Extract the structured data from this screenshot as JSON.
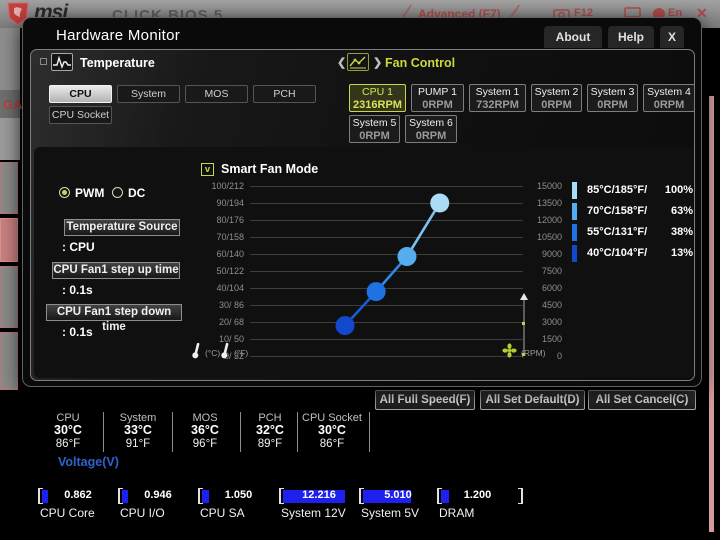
{
  "top_bar": {
    "logo_text": "msi",
    "bios_title": "CLICK BIOS 5",
    "advanced": "Advanced (F7)",
    "f12": "F12",
    "lang": "En",
    "close": "✕",
    "ga_label": "GA"
  },
  "dialog": {
    "title": "Hardware Monitor",
    "buttons": {
      "about": "About",
      "help": "Help",
      "close": "X"
    },
    "temperature": {
      "title": "Temperature",
      "tabs": [
        {
          "label": "CPU",
          "selected": true
        },
        {
          "label": "System",
          "selected": false
        },
        {
          "label": "MOS",
          "selected": false
        },
        {
          "label": "PCH",
          "selected": false
        },
        {
          "label": "CPU Socket",
          "selected": false
        }
      ]
    },
    "fan_control": {
      "title": "Fan Control",
      "fans": [
        {
          "name": "CPU 1",
          "rpm": "2316RPM",
          "selected": true
        },
        {
          "name": "PUMP 1",
          "rpm": "0RPM",
          "selected": false
        },
        {
          "name": "System 1",
          "rpm": "732RPM",
          "selected": false
        },
        {
          "name": "System 2",
          "rpm": "0RPM",
          "selected": false
        },
        {
          "name": "System 3",
          "rpm": "0RPM",
          "selected": false
        },
        {
          "name": "System 4",
          "rpm": "0RPM",
          "selected": false
        },
        {
          "name": "System 5",
          "rpm": "0RPM",
          "selected": false
        },
        {
          "name": "System 6",
          "rpm": "0RPM",
          "selected": false
        }
      ]
    },
    "controls": {
      "pwm_label": "PWM",
      "dc_label": "DC",
      "selected_mode": "PWM",
      "settings": [
        {
          "label": "Temperature Source",
          "value": ": CPU"
        },
        {
          "label": "CPU Fan1 step up time",
          "value": ": 0.1s"
        },
        {
          "label": "CPU Fan1 step down time",
          "value": ": 0.1s"
        }
      ]
    },
    "smart_fan": {
      "label": "Smart Fan Mode",
      "checked": true,
      "check_glyph": "v"
    },
    "chart_data": {
      "type": "line",
      "title": "Smart Fan Mode fan curve",
      "x_axis_units": [
        "(°C)",
        "(°F)"
      ],
      "y_right_unit": "(RPM)",
      "points": [
        {
          "temp_c": 40,
          "temp_f": 104,
          "duty_pct": 13
        },
        {
          "temp_c": 55,
          "temp_f": 131,
          "duty_pct": 38
        },
        {
          "temp_c": 70,
          "temp_f": 158,
          "duty_pct": 63
        },
        {
          "temp_c": 85,
          "temp_f": 185,
          "duty_pct": 100
        }
      ],
      "point_fracs": [
        [
          0.348,
          0.179
        ],
        [
          0.462,
          0.379
        ],
        [
          0.575,
          0.585
        ],
        [
          0.695,
          0.9
        ]
      ],
      "point_colors": [
        "#1148cc",
        "#1e72e2",
        "#55acee",
        "#aadcf6"
      ],
      "segment_colors": [
        "#1b5ad6",
        "#2f8ae6",
        "#7cc2f0"
      ],
      "left_ticks": [
        "100/212",
        "90/194",
        "80/176",
        "70/158",
        "60/140",
        "50/122",
        "40/104",
        "30/ 86",
        "20/ 68",
        "10/ 50",
        "0/ 32"
      ],
      "right_ticks": [
        "15000",
        "13500",
        "12000",
        "10500",
        "9000",
        "7500",
        "6000",
        "4500",
        "3000",
        "1500",
        "0"
      ],
      "grid": true
    },
    "legend": [
      {
        "label": "85°C/185°F/",
        "pct": "100%",
        "color": "#aadcf6"
      },
      {
        "label": "70°C/158°F/",
        "pct": "63%",
        "color": "#55acee"
      },
      {
        "label": "55°C/131°F/",
        "pct": "38%",
        "color": "#1e72e2"
      },
      {
        "label": "40°C/104°F/",
        "pct": "13%",
        "color": "#1148cc"
      }
    ]
  },
  "action_buttons": [
    "All Full Speed(F)",
    "All Set Default(D)",
    "All Set Cancel(C)"
  ],
  "status": {
    "temps": [
      {
        "label": "CPU",
        "c": "30°C",
        "f": "86°F"
      },
      {
        "label": "System",
        "c": "33°C",
        "f": "91°F"
      },
      {
        "label": "MOS",
        "c": "36°C",
        "f": "96°F"
      },
      {
        "label": "PCH",
        "c": "32°C",
        "f": "89°F"
      },
      {
        "label": "CPU Socket",
        "c": "30°C",
        "f": "86°F"
      }
    ],
    "voltage_title": "Voltage(V)",
    "voltages": [
      {
        "label": "CPU Core",
        "value": "0.862",
        "fill_pct": 8
      },
      {
        "label": "CPU I/O",
        "value": "0.946",
        "fill_pct": 8
      },
      {
        "label": "CPU SA",
        "value": "1.050",
        "fill_pct": 9
      },
      {
        "label": "System 12V",
        "value": "12.216",
        "fill_pct": 84
      },
      {
        "label": "System 5V",
        "value": "5.010",
        "fill_pct": 66
      },
      {
        "label": "DRAM",
        "value": "1.200",
        "fill_pct": 10
      }
    ],
    "bar_color": "#2020ee"
  }
}
